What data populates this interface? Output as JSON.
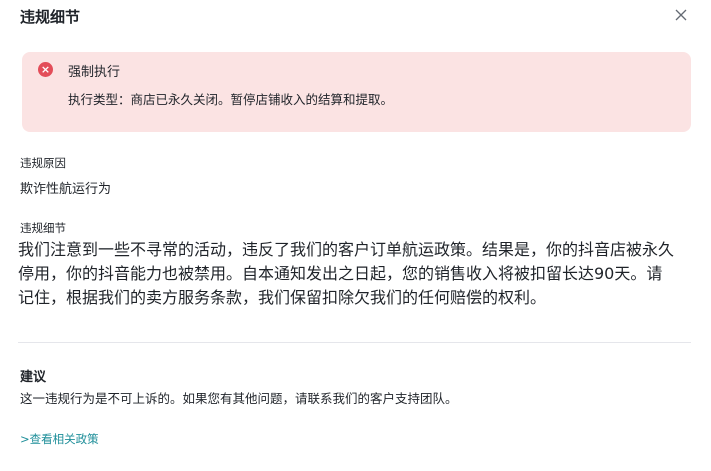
{
  "header": {
    "title": "违规细节",
    "close_icon": "close-icon"
  },
  "alert": {
    "icon": "error-circle-icon",
    "icon_glyph": "×",
    "title": "强制执行",
    "description": "执行类型：商店已永久关闭。暂停店铺收入的结算和提取。",
    "background_color": "#fbe3e3",
    "icon_color": "#e34d59"
  },
  "reason": {
    "label": "违规原因",
    "value": "欺诈性航运行为"
  },
  "detail": {
    "label": "违规细节",
    "text": "我们注意到一些不寻常的活动，违反了我们的客户订单航运政策。结果是，你的抖音店被永久停用，你的抖音能力也被禁用。自本通知发出之日起，您的销售收入将被扣留长达90天。请记住，根据我们的卖方服务条款，我们保留扣除欠我们的任何赔偿的权利。"
  },
  "suggestion": {
    "title": "建议",
    "text": "这一违规行为是不可上诉的。如果您有其他问题，请联系我们的客户支持团队。"
  },
  "link": {
    "label": ">查看相关政策",
    "color": "#1f8f9a"
  }
}
